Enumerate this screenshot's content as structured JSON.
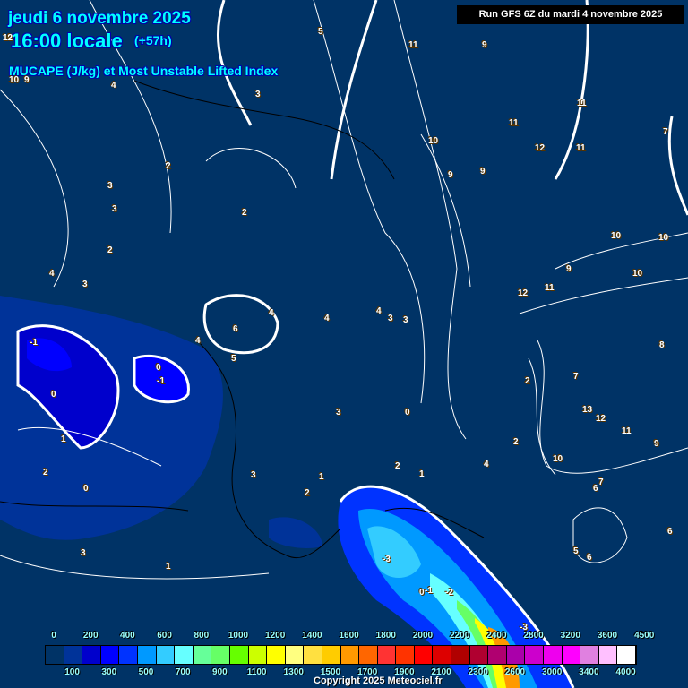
{
  "header": {
    "date": "jeudi 6 novembre 2025",
    "time": "16:00 locale",
    "lead": "(+57h)",
    "parameter": "MUCAPE (J/kg) et Most Unstable Lifted Index",
    "run": "Run GFS 6Z du mardi 4 novembre 2025"
  },
  "legend": {
    "colors": [
      "#0a1540",
      "#003366",
      "#003399",
      "#0000cc",
      "#0000ff",
      "#0033ff",
      "#0099ff",
      "#33ccff",
      "#66ffff",
      "#66ff99",
      "#66ff66",
      "#66ff00",
      "#ccff00",
      "#ffff00",
      "#ffff80",
      "#ffe040",
      "#ffcc00",
      "#ff9900",
      "#ff6600",
      "#ff3333",
      "#ff3300",
      "#ff0000",
      "#dd0000",
      "#b00000",
      "#b00030",
      "#b00070",
      "#aa00aa",
      "#cc00cc",
      "#ee00ee",
      "#ff00ff",
      "#e080e0",
      "#ffc0ff",
      "#ffffff"
    ],
    "top_ticks": [
      "0",
      "200",
      "400",
      "600",
      "800",
      "1000",
      "1200",
      "1400",
      "1600",
      "1800",
      "2000",
      "2200",
      "2400",
      "2800",
      "3200",
      "3600",
      "4500"
    ],
    "bottom_ticks": [
      "100",
      "300",
      "500",
      "700",
      "900",
      "1100",
      "1300",
      "1500",
      "1700",
      "1900",
      "2100",
      "2300",
      "2600",
      "3000",
      "3400",
      "4000"
    ]
  },
  "lifted_index_labels": [
    "10",
    "12",
    "10",
    "9",
    "4",
    "3",
    "2",
    "3",
    "3",
    "2",
    "4",
    "3",
    "2",
    "6",
    "4",
    "4",
    "5",
    "4",
    "3",
    "4",
    "-1",
    "0",
    "-1",
    "0",
    "1",
    "2",
    "0",
    "3",
    "1",
    "3",
    "2",
    "1",
    "3",
    "5",
    "11",
    "9",
    "10",
    "9",
    "9",
    "11",
    "12",
    "11",
    "7",
    "8",
    "11",
    "10",
    "9",
    "10",
    "12",
    "11",
    "10",
    "13",
    "12",
    "11",
    "9",
    "6",
    "7",
    "5",
    "6",
    "6",
    "2",
    "4",
    "3",
    "0",
    "-1",
    "-2",
    "-3",
    "-3",
    "0",
    "2",
    "1",
    "2",
    "7",
    "10"
  ],
  "copyright": "Copyright 2025 Meteociel.fr"
}
